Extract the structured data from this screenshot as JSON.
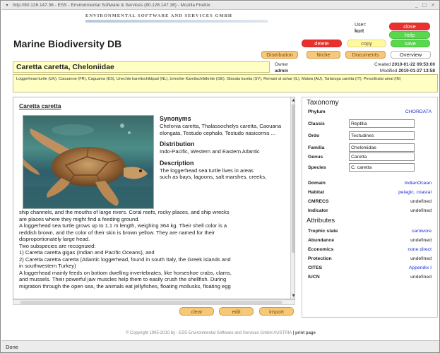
{
  "window": {
    "title": "http://80.126.147.36 - ESS - Environmental Software & Services (80.126.147.36) - Mozilla Firefox"
  },
  "header": {
    "company": "ENVIRONMENTAL SOFTWARE AND SERVICES GMBH",
    "app_title": "Marine Biodiversity DB",
    "user_label": "User:",
    "user_value": "kurt",
    "buttons": {
      "close": "close",
      "help": "help",
      "delete": "delete",
      "copy": "copy",
      "save": "save"
    },
    "tabs": [
      "Distribution",
      "Niche",
      "Documents",
      "Overview"
    ]
  },
  "record": {
    "species": "Caretta caretta, Cheloniidae",
    "owner_label": "Owner",
    "owner_value": "admin",
    "created_label": "Created",
    "created_value": "2010-01-22 09:53:00",
    "modified_label": "Modified",
    "modified_value": "2010-01-27 13:58",
    "common_names": "Loggerhead turtle (UK), Caouanne (FR), Caguama (ES), Unechte karettschildpad (NL), Unechte Karettschildkröte (GE), Glavata kareta (SV), Remani al ashar (IL), Maiwa (AU), Tartaruga caretta (IT), Perunthalai amai (IN)"
  },
  "description": {
    "species_head": "Caretta caretta",
    "synonyms_title": "Synonyms",
    "synonyms": "Chelonia caretta, Thalassochelys caretta, Caouana elongata, Testudo cephalo, Testudo nasicornis ...",
    "distribution_title": "Distribution",
    "distribution": "Indo-Pacific, Western and Eastern Atlantic",
    "description_title": "Description",
    "desc_lines_top": [
      "The loggerhead sea turtle lives in areas",
      "such as bays, lagoons, salt marshes, creeks,"
    ],
    "desc_lines_bottom": [
      "ship channels, and the mouths of large rivers. Coral reefs, rocky places, and ship wrecks",
      "are places where they might find a feeding ground.",
      "A loggerhead sea turtle grows up to 1.1 m length, weighing 364 kg. Their shell color is a",
      "reddish brown, and the color of their skin is brown yellow. They are named for their",
      "disproportionately large head.",
      "Two subspecies are recognized:",
      "1) Caretta caretta gigas (Indian and Pacific Oceans), and",
      "2) Caretta caretta caretta (Atlantic loggerhead, found in south Italy, the Greek islands and",
      "in southwestern Turkey)",
      "A loggerhead mainly feeds on bottom dwelling invertebrates, like horseshoe crabs, clams,",
      "and mussels. Their powerful jaw muscles help them to easily crush the shellfish. During",
      "migration through the open sea, the animals eat jellyfishes, floating mollusks, floating egg"
    ],
    "buttons": [
      "clear",
      "edit",
      "import"
    ]
  },
  "taxonomy": {
    "title": "Taxonomy",
    "phylum_label": "Phylum",
    "phylum_value": "CHORDATA",
    "fields": [
      {
        "label": "Classis",
        "value": "Reptilia"
      },
      {
        "label": "Ordo",
        "value": "Testudines"
      },
      {
        "label": "Familia",
        "value": "Cheloniidae"
      },
      {
        "label": "Genus",
        "value": "Caretta"
      },
      {
        "label": "Species",
        "value": "C. caretta"
      }
    ],
    "meta": [
      {
        "label": "Domain",
        "value": "IndianOcean",
        "link": true
      },
      {
        "label": "Habitat",
        "value": "pelagic, coastal",
        "link": true
      },
      {
        "label": "CMRECS",
        "value": "undefined",
        "link": false
      },
      {
        "label": "Indicator",
        "value": "undefined",
        "link": false
      }
    ],
    "attributes_title": "Attributes",
    "attributes": [
      {
        "label": "Trophic state",
        "value": "carnivore",
        "link": true
      },
      {
        "label": "Abundance",
        "value": "undefined",
        "link": false
      },
      {
        "label": "Economics",
        "value": "none direct",
        "link": true
      },
      {
        "label": "Protection",
        "value": "undefined",
        "link": false
      },
      {
        "label": "CITES",
        "value": "Appendix I",
        "link": true
      },
      {
        "label": "IUCN",
        "value": "undefined",
        "link": false
      }
    ]
  },
  "footer": {
    "copyright": "© Copyright 1995-2010 by : ESS  Environmental Software and Services GmbH AUSTRIA",
    "print_label": "print page"
  },
  "status": {
    "text": "Done"
  },
  "colors": {
    "close": "#e8312e",
    "help": "#58d84c",
    "delete": "#e8312e",
    "copy": "#fff89c",
    "save": "#58d84c",
    "tab": "#f6c97a",
    "yellow_field": "#ffffc4",
    "link": "#1a2fd1"
  }
}
